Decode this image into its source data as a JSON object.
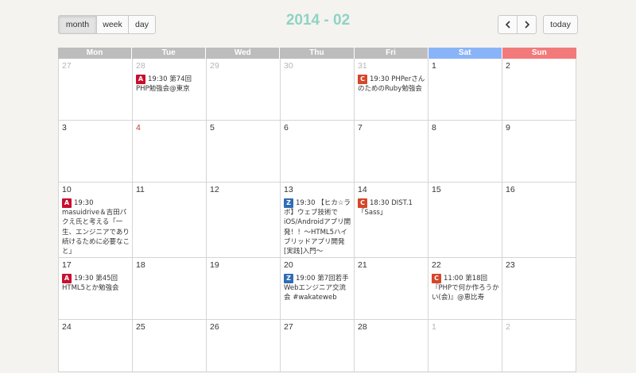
{
  "toolbar": {
    "views": [
      {
        "label": "month",
        "active": true
      },
      {
        "label": "week",
        "active": false
      },
      {
        "label": "day",
        "active": false
      }
    ],
    "title": "2014 - 02",
    "prev_icon": "chevron-left-icon",
    "next_icon": "chevron-right-icon",
    "today_label": "today"
  },
  "colors": {
    "header_weekday": "#bdbdbd",
    "header_sat": "#8ab4f8",
    "header_sun": "#f27a7a",
    "title": "#8fd3c5",
    "badge_A": "#c8102e",
    "badge_C": "#d5462a",
    "badge_Z": "#2f6db5"
  },
  "weekdays": [
    "Mon",
    "Tue",
    "Wed",
    "Thu",
    "Fri",
    "Sat",
    "Sun"
  ],
  "weeks": [
    {
      "days": [
        {
          "num": "27",
          "other": true,
          "events": []
        },
        {
          "num": "28",
          "other": true,
          "events": [
            {
              "badge": "A",
              "text": "19:30 第74回PHP勉強会@東京"
            }
          ]
        },
        {
          "num": "29",
          "other": true,
          "events": []
        },
        {
          "num": "30",
          "other": true,
          "events": []
        },
        {
          "num": "31",
          "other": true,
          "events": [
            {
              "badge": "C",
              "text": "19:30 PHPerさんのためのRuby勉強会"
            }
          ]
        },
        {
          "num": "1",
          "events": []
        },
        {
          "num": "2",
          "events": []
        }
      ]
    },
    {
      "days": [
        {
          "num": "3",
          "events": []
        },
        {
          "num": "4",
          "holiday": true,
          "events": []
        },
        {
          "num": "5",
          "events": []
        },
        {
          "num": "6",
          "events": []
        },
        {
          "num": "7",
          "events": []
        },
        {
          "num": "8",
          "events": []
        },
        {
          "num": "9",
          "events": []
        }
      ]
    },
    {
      "days": [
        {
          "num": "10",
          "events": [
            {
              "badge": "A",
              "text": "19:30 masuidrive＆吉田パクえ氏と考える「一生、エンジニアであり続けるために必要なこと」"
            }
          ]
        },
        {
          "num": "11",
          "events": []
        },
        {
          "num": "12",
          "events": []
        },
        {
          "num": "13",
          "events": [
            {
              "badge": "Z",
              "text": "19:30 【ヒカ☆ラボ】ウェブ技術でiOS/Androidアプリ開発！！〜HTML5ハイブリッドアプリ開発[実践]入門〜"
            }
          ]
        },
        {
          "num": "14",
          "events": [
            {
              "badge": "C",
              "text": "18:30 DIST.1「Sass」"
            }
          ]
        },
        {
          "num": "15",
          "events": []
        },
        {
          "num": "16",
          "events": []
        }
      ]
    },
    {
      "days": [
        {
          "num": "17",
          "events": [
            {
              "badge": "A",
              "text": "19:30 第45回HTML5とか勉強会"
            }
          ]
        },
        {
          "num": "18",
          "events": []
        },
        {
          "num": "19",
          "events": []
        },
        {
          "num": "20",
          "events": [
            {
              "badge": "Z",
              "text": "19:00 第7回若手Webエンジニア交流会 #wakateweb"
            }
          ]
        },
        {
          "num": "21",
          "events": []
        },
        {
          "num": "22",
          "events": [
            {
              "badge": "C",
              "text": "11:00 第18回『PHPで何か作ろうかい(会)』@恵比寿"
            }
          ]
        },
        {
          "num": "23",
          "events": []
        }
      ]
    },
    {
      "days": [
        {
          "num": "24",
          "events": []
        },
        {
          "num": "25",
          "events": []
        },
        {
          "num": "26",
          "events": []
        },
        {
          "num": "27",
          "events": []
        },
        {
          "num": "28",
          "events": []
        },
        {
          "num": "1",
          "other": true,
          "events": []
        },
        {
          "num": "2",
          "other": true,
          "events": []
        }
      ]
    }
  ]
}
